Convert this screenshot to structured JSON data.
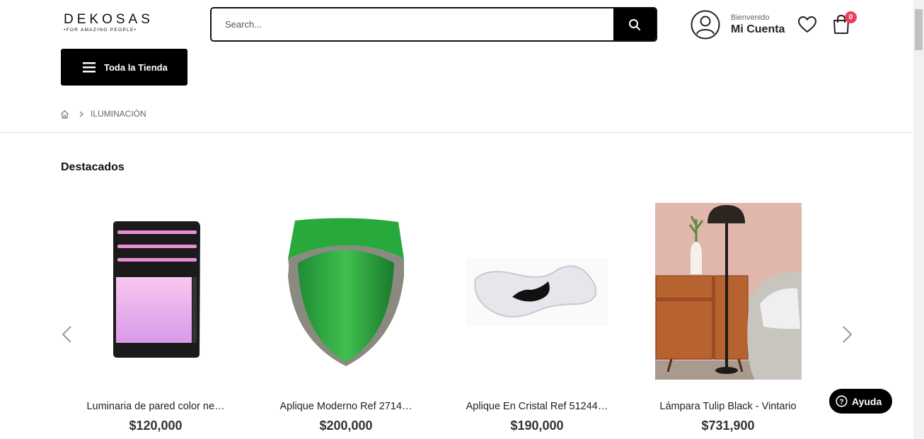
{
  "header": {
    "logo": {
      "name": "DEKOSAS",
      "tagline": "•FOR AMAZING PEOPLE•"
    },
    "search": {
      "placeholder": "Search...",
      "value": ""
    },
    "account": {
      "welcome": "Bienvenido",
      "name": "Mi Cuenta"
    },
    "cart": {
      "count": "0"
    }
  },
  "nav": {
    "store_button": "Toda la Tienda"
  },
  "breadcrumb": {
    "current": "ILUMINACIÓN"
  },
  "section": {
    "title": "Destacados"
  },
  "products": [
    {
      "name": "Luminaria de pared color ne…",
      "price": "$120,000"
    },
    {
      "name": "Aplique Moderno Ref 2714…",
      "price": "$200,000"
    },
    {
      "name": "Aplique En Cristal Ref 51244…",
      "price": "$190,000"
    },
    {
      "name": "Lámpara Tulip Black - Vintario",
      "price": "$731,900"
    }
  ],
  "help": {
    "label": "Ayuda"
  },
  "colors": {
    "accent": "#000000",
    "badge": "#ee3d5a"
  }
}
